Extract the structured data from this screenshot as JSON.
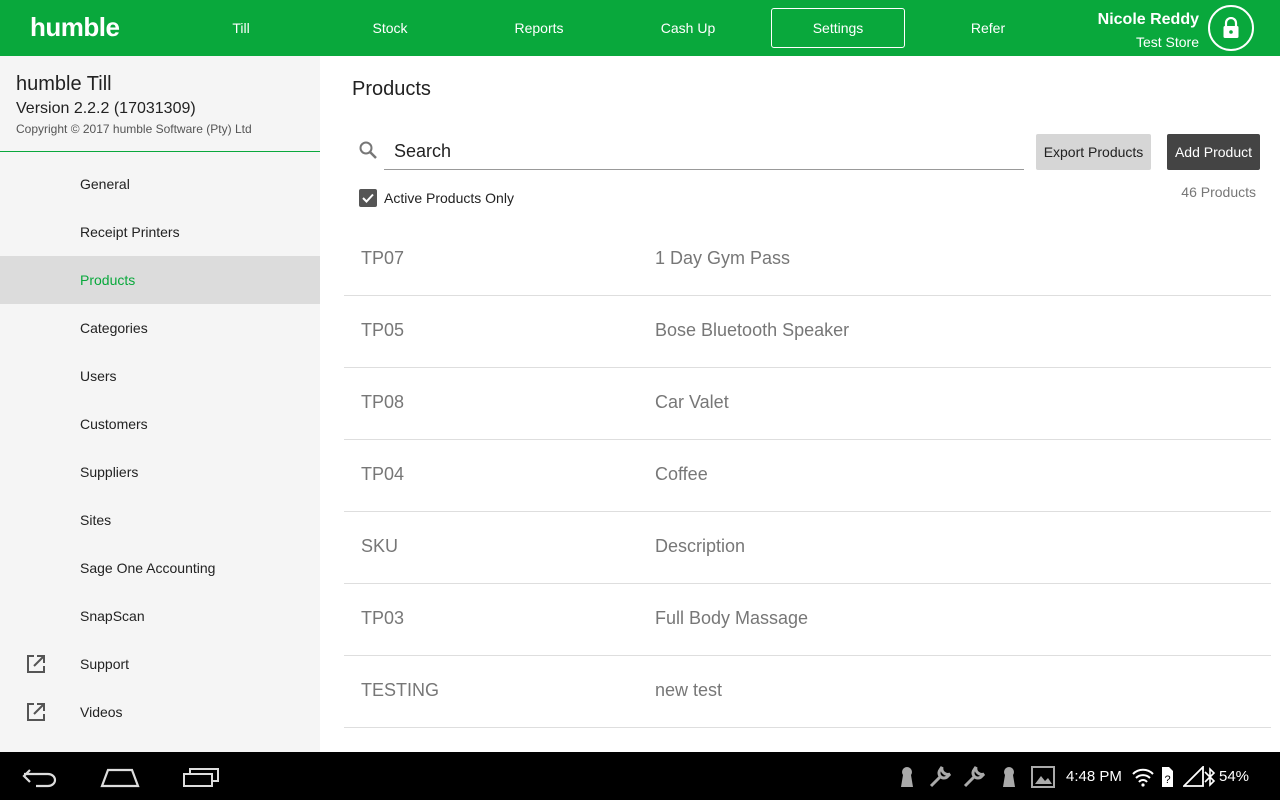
{
  "header": {
    "logo": "humble",
    "nav": [
      {
        "label": "Till"
      },
      {
        "label": "Stock"
      },
      {
        "label": "Reports"
      },
      {
        "label": "Cash Up"
      },
      {
        "label": "Settings",
        "active": true
      },
      {
        "label": "Refer"
      }
    ],
    "user_name": "Nicole Reddy",
    "store_name": "Test Store",
    "lock_icon": "lock-icon"
  },
  "sidebar": {
    "app_title": "humble Till",
    "version": "Version 2.2.2 (17031309)",
    "copyright": "Copyright © 2017 humble Software (Pty) Ltd",
    "items": [
      {
        "label": "General"
      },
      {
        "label": "Receipt Printers"
      },
      {
        "label": "Products",
        "active": true
      },
      {
        "label": "Categories"
      },
      {
        "label": "Users"
      },
      {
        "label": "Customers"
      },
      {
        "label": "Suppliers"
      },
      {
        "label": "Sites"
      },
      {
        "label": "Sage One Accounting"
      },
      {
        "label": "SnapScan"
      },
      {
        "label": "Support",
        "icon": "external-link-icon"
      },
      {
        "label": "Videos",
        "icon": "external-link-icon"
      }
    ]
  },
  "main": {
    "title": "Products",
    "search_placeholder": "Search",
    "export_label": "Export Products",
    "add_label": "Add Product",
    "active_only_label": "Active Products Only",
    "active_only_checked": true,
    "count_label": "46 Products",
    "products": [
      {
        "sku": "TP07",
        "description": "1 Day Gym Pass"
      },
      {
        "sku": "TP05",
        "description": "Bose Bluetooth Speaker"
      },
      {
        "sku": "TP08",
        "description": "Car Valet"
      },
      {
        "sku": "TP04",
        "description": "Coffee"
      },
      {
        "sku": "SKU",
        "description": "Description"
      },
      {
        "sku": "TP03",
        "description": "Full Body Massage"
      },
      {
        "sku": "TESTING",
        "description": "new test"
      }
    ]
  },
  "system_bar": {
    "time": "4:48 PM",
    "battery": "54%",
    "accent_color": "#09a83c"
  }
}
